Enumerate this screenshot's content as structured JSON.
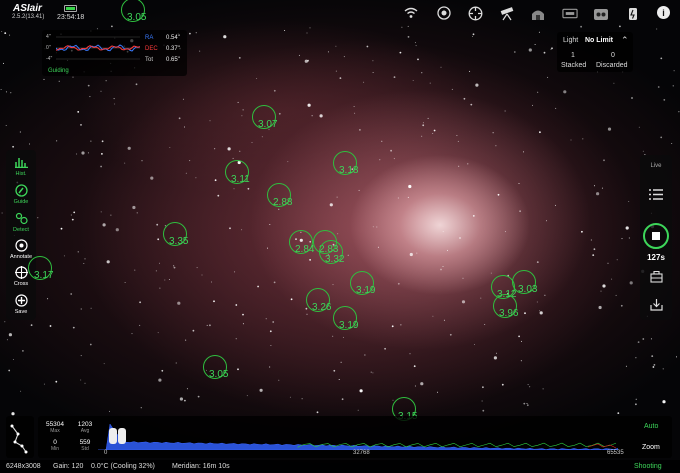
{
  "app": {
    "name": "ASIair",
    "version": "2.5.2(13.41)",
    "clock": "23:54:18"
  },
  "topbar": {
    "icons": [
      "wifi-icon",
      "camera-icon",
      "focuser-icon",
      "telescope-icon",
      "guide-scope-icon",
      "filter-wheel-icon",
      "efw-icon",
      "power-icon",
      "info-icon"
    ]
  },
  "guiding": {
    "axis": [
      "4''",
      "0''",
      "-4''"
    ],
    "rows": [
      {
        "label": "RA",
        "value": "0.54''",
        "color": "#3a7bff"
      },
      {
        "label": "DEC",
        "value": "0.37''",
        "color": "#ff3b3b"
      },
      {
        "label": "Tot",
        "value": "0.65''",
        "color": "#cccccc"
      }
    ],
    "status": "Guiding"
  },
  "stack": {
    "frame_type": "Light",
    "limit": "No Limit",
    "stacked_count": "1",
    "stacked_label": "Stacked",
    "discarded_count": "0",
    "discarded_label": "Discarded"
  },
  "left_tools": [
    {
      "label": "Hist.",
      "icon": "histogram-icon",
      "active": true
    },
    {
      "label": "Guide",
      "icon": "guide-icon",
      "active": true
    },
    {
      "label": "Detect",
      "icon": "detect-icon",
      "active": true
    },
    {
      "label": "Annotate",
      "icon": "annotate-icon",
      "active": false
    },
    {
      "label": "Cross",
      "icon": "crosshair-icon",
      "active": false
    },
    {
      "label": "Save",
      "icon": "save-icon",
      "active": false
    }
  ],
  "right_bar": {
    "live_label": "Live",
    "exposure": "127s"
  },
  "stars": [
    "3.05",
    "3.07",
    "3.11",
    "3.18",
    "2.88",
    "3.35",
    "2.84",
    "2.83",
    "3.17",
    "3.32",
    "3.19",
    "3.12",
    "3.03",
    "3.96",
    "3.26",
    "3.19",
    "3.05",
    "3.15"
  ],
  "histogram": {
    "max_value": "55304",
    "max_label": "Max",
    "avg_value": "1203",
    "avg_label": "Avg",
    "min_value": "0",
    "min_label": "Min",
    "std_value": "559",
    "std_label": "Std",
    "ticks": [
      "0",
      "32768",
      "65535"
    ],
    "auto_label": "Auto",
    "zoom_label": "Zoom"
  },
  "status": {
    "resolution": "6248x3008",
    "gain": "Gain: 120",
    "temperature": "0.0°C (Cooling 32%)",
    "meridian": "Meridian: 16m 10s",
    "state": "Shooting"
  }
}
